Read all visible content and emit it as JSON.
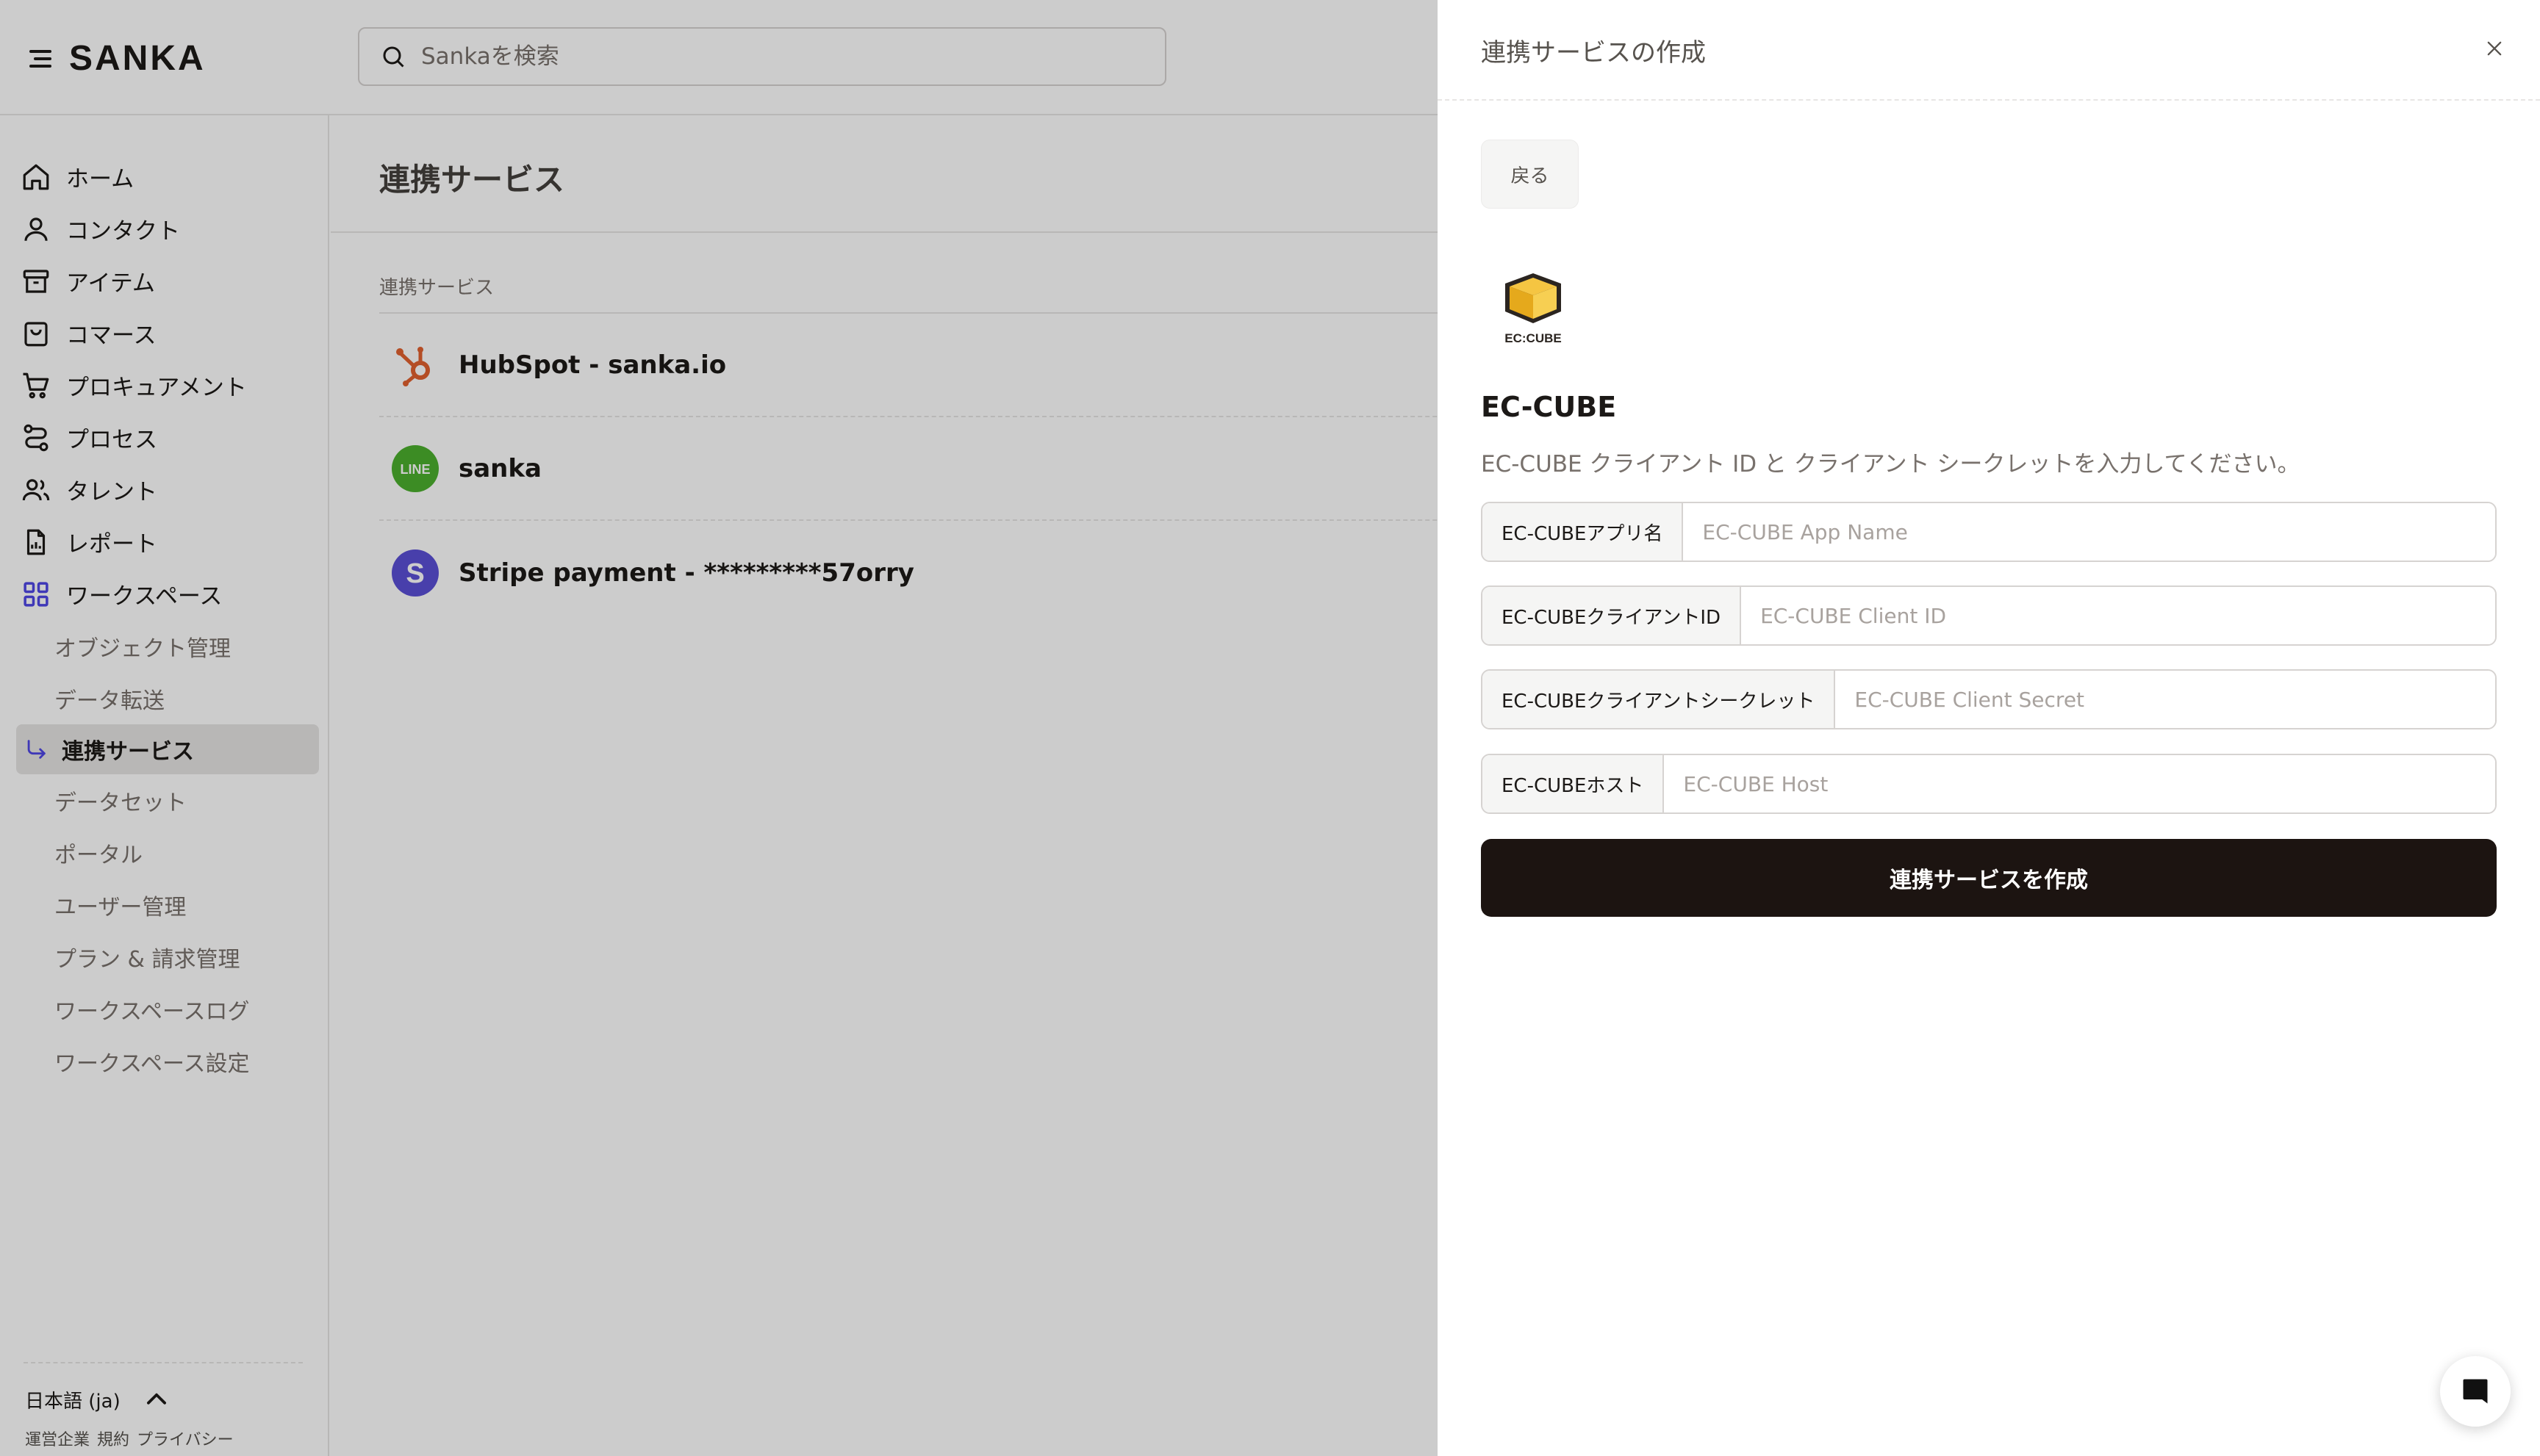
{
  "app": {
    "brand": "SANKA"
  },
  "search": {
    "placeholder": "Sankaを検索"
  },
  "sidebar": {
    "items": [
      {
        "label": "ホーム",
        "icon": "home-icon"
      },
      {
        "label": "コンタクト",
        "icon": "user-icon"
      },
      {
        "label": "アイテム",
        "icon": "archive-icon"
      },
      {
        "label": "コマース",
        "icon": "shopping-bag-icon"
      },
      {
        "label": "プロキュアメント",
        "icon": "cart-icon"
      },
      {
        "label": "プロセス",
        "icon": "route-icon"
      },
      {
        "label": "タレント",
        "icon": "users-icon"
      },
      {
        "label": "レポート",
        "icon": "report-icon"
      },
      {
        "label": "ワークスペース",
        "icon": "grid-icon"
      }
    ],
    "sub_items": [
      {
        "label": "オブジェクト管理",
        "active": false
      },
      {
        "label": "データ転送",
        "active": false
      },
      {
        "label": "連携サービス",
        "active": true
      },
      {
        "label": "データセット",
        "active": false
      },
      {
        "label": "ポータル",
        "active": false
      },
      {
        "label": "ユーザー管理",
        "active": false
      },
      {
        "label": "プラン & 請求管理",
        "active": false
      },
      {
        "label": "ワークスペースログ",
        "active": false
      },
      {
        "label": "ワークスペース設定",
        "active": false
      }
    ],
    "footer": {
      "language": "日本語 (ja)",
      "links": [
        "運営企業",
        "規約",
        "プライバシー"
      ]
    }
  },
  "main": {
    "title": "連携サービス",
    "section_label": "連携サービス",
    "integrations": [
      {
        "name": "HubSpot - sanka.io",
        "icon": "hubspot-icon"
      },
      {
        "name": "sanka",
        "icon": "line-icon",
        "badge": "LINE"
      },
      {
        "name": "Stripe payment - *********57orry",
        "icon": "stripe-icon",
        "badge": "S"
      }
    ]
  },
  "drawer": {
    "title": "連携サービスの作成",
    "back_label": "戻る",
    "logo_text": "EC:CUBE",
    "service_name": "EC-CUBE",
    "description": "EC-CUBE クライアント ID と クライアント シークレットを入力してください。",
    "fields": [
      {
        "label": "EC-CUBEアプリ名",
        "placeholder": "EC-CUBE App Name"
      },
      {
        "label": "EC-CUBEクライアントID",
        "placeholder": "EC-CUBE Client ID"
      },
      {
        "label": "EC-CUBEクライアントシークレット",
        "placeholder": "EC-CUBE Client Secret"
      },
      {
        "label": "EC-CUBEホスト",
        "placeholder": "EC-CUBE Host"
      }
    ],
    "submit_label": "連携サービスを作成"
  },
  "colors": {
    "accent": "#4f46e5",
    "hubspot": "#ff7a59",
    "line": "#4cb02d",
    "stripe": "#5b4fd6",
    "submit": "#1c1411"
  }
}
